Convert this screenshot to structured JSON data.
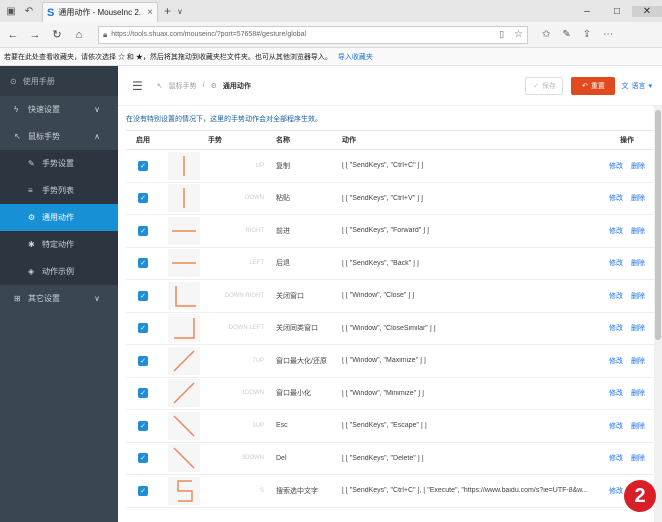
{
  "browser": {
    "tab_title": "通用动作 - MouseInc 2.",
    "url": "https://tools.shuax.com/mouseinc/?port=57658#/gesture/global"
  },
  "favbar": {
    "text": "若要在此处查看收藏夹，请依次选择 ☆ 和 ★，然后将其拖动到收藏夹栏文件夹。也可从其他浏览器导入。",
    "link": "导入收藏夹"
  },
  "sidebar": {
    "header": "使用手册",
    "items": [
      {
        "label": "快速设置",
        "icon": "bolt-icon"
      },
      {
        "label": "鼠标手势",
        "icon": "mouse-icon"
      }
    ],
    "subitems": [
      {
        "label": "手势设置",
        "icon": "pen-icon"
      },
      {
        "label": "手势列表",
        "icon": "list-icon"
      },
      {
        "label": "通用动作",
        "icon": "gear-icon"
      },
      {
        "label": "特定动作",
        "icon": "star-icon"
      },
      {
        "label": "动作示例",
        "icon": "cube-icon"
      }
    ],
    "footer_item": {
      "label": "其它设置",
      "icon": "grid-icon"
    }
  },
  "topbar": {
    "breadcrumb": [
      "鼠标手势",
      "通用动作"
    ],
    "save_label": "保存",
    "reset_label": "重置",
    "lang_label": "语言"
  },
  "hint": "在没有特别设置的情况下，这里的手势动作会对全部程序生效。",
  "table": {
    "headers": {
      "enabled": "启用",
      "gesture": "手势",
      "name": "名称",
      "action": "动作",
      "ops": "操作"
    },
    "edit_label": "修改",
    "delete_label": "删除",
    "rows": [
      {
        "gesture": "UP",
        "name": "复制",
        "action": "[ [ \"SendKeys\", \"Ctrl+C\" ] ]"
      },
      {
        "gesture": "DOWN",
        "name": "粘贴",
        "action": "[ [ \"SendKeys\", \"Ctrl+V\" ] ]"
      },
      {
        "gesture": "RIGHT",
        "name": "前进",
        "action": "[ [ \"SendKeys\", \"Forward\" ] ]"
      },
      {
        "gesture": "LEFT",
        "name": "后退",
        "action": "[ [ \"SendKeys\", \"Back\" ] ]"
      },
      {
        "gesture": "DOWN RIGHT",
        "name": "关闭窗口",
        "action": "[ [ \"Window\", \"Close\" ] ]"
      },
      {
        "gesture": "DOWN LEFT",
        "name": "关闭同类窗口",
        "action": "[ [ \"Window\", \"CloseSimilar\" ] ]"
      },
      {
        "gesture": "7UP",
        "name": "窗口最大化/还原",
        "action": "[ [ \"Window\", \"Maximize\" ] ]"
      },
      {
        "gesture": "1DOWN",
        "name": "窗口最小化",
        "action": "[ [ \"Window\", \"Minimize\" ] ]"
      },
      {
        "gesture": "3UP",
        "name": "Esc",
        "action": "[ [ \"SendKeys\", \"Escape\" ] ]"
      },
      {
        "gesture": "3DOWN",
        "name": "Del",
        "action": "[ [ \"SendKeys\", \"Delete\" ] ]"
      },
      {
        "gesture": "S",
        "name": "搜索选中文字",
        "action": "[ [ \"SendKeys\", \"Ctrl+C\" ], [ \"Execute\", \"https://www.baidu.com/s?ie=UTF-8&w..."
      }
    ]
  },
  "badge": "2",
  "colors": {
    "sidebar": "#3b4653",
    "accent": "#1890d6",
    "reset": "#e14a1f",
    "badge": "#d81e27"
  }
}
